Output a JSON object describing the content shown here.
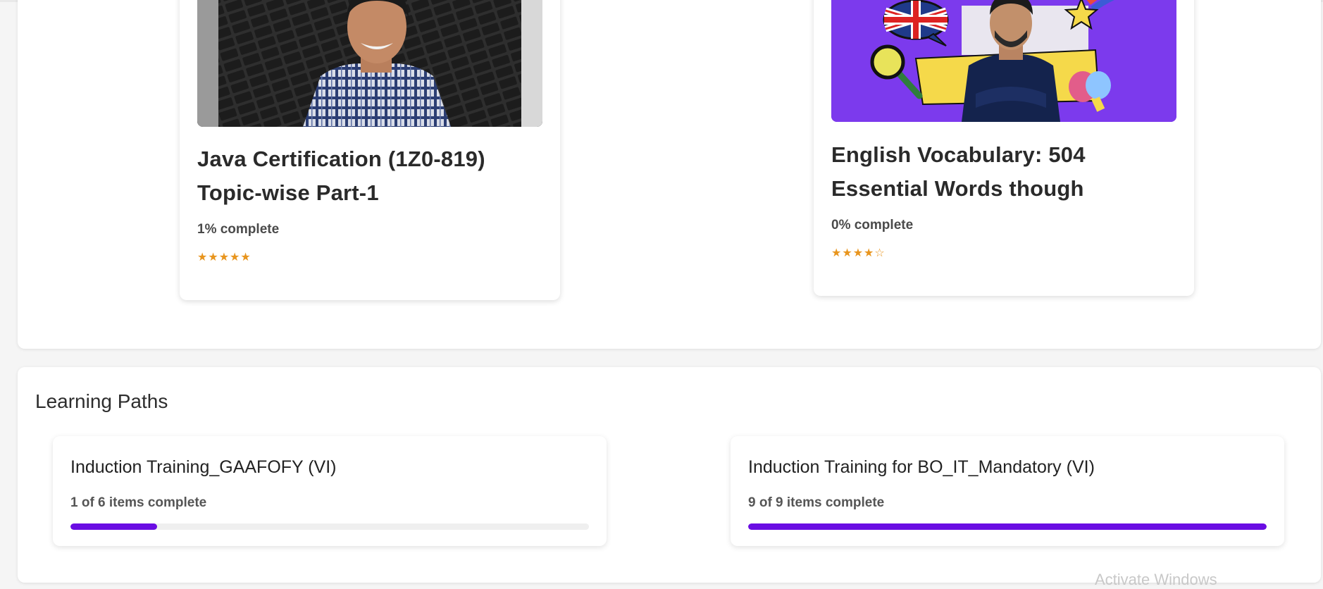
{
  "courses": [
    {
      "title": "Java Certification (1Z0-819) Topic-wise Part-1",
      "progress_text": "1% complete",
      "rating_stars": "★★★★★",
      "thumbnail_icon": "instructor-photo"
    },
    {
      "title": "English Vocabulary: 504 Essential Words though",
      "progress_text": "0% complete",
      "rating_stars": "★★★★☆",
      "thumbnail_icon": "instructor-photo-with-uk-flag"
    }
  ],
  "learning_paths": {
    "heading": "Learning Paths",
    "items": [
      {
        "title": "Induction Training_GAAFOFY (VI)",
        "progress_text": "1 of 6 items complete",
        "progress_fraction": 0.1667
      },
      {
        "title": "Induction Training for BO_IT_Mandatory (VI)",
        "progress_text": "9 of 9 items complete",
        "progress_fraction": 1.0
      }
    ]
  },
  "watermark": "Activate Windows",
  "colors": {
    "accent": "#6a0de3",
    "star": "#e8951e",
    "english_thumb_bg": "#7c3aed"
  }
}
